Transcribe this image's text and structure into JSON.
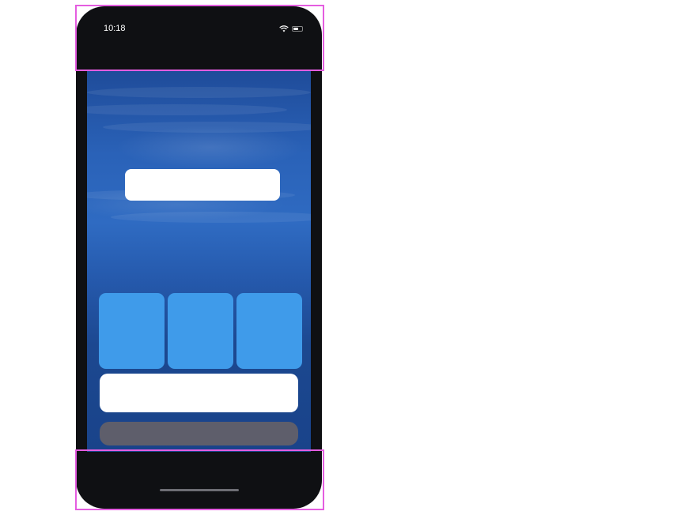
{
  "status_bar": {
    "time": "10:18",
    "wifi_icon": "wifi-icon",
    "battery_icon": "battery-icon",
    "battery_level": 0.6
  },
  "colors": {
    "phone_frame": "#0f1013",
    "screen_top": "#1f4c9a",
    "screen_bottom": "#19438a",
    "tile": "#3f9bea",
    "field": "#ffffff",
    "gray_bar": "#5e5e6b",
    "annotation_outline": "#e45de0"
  }
}
